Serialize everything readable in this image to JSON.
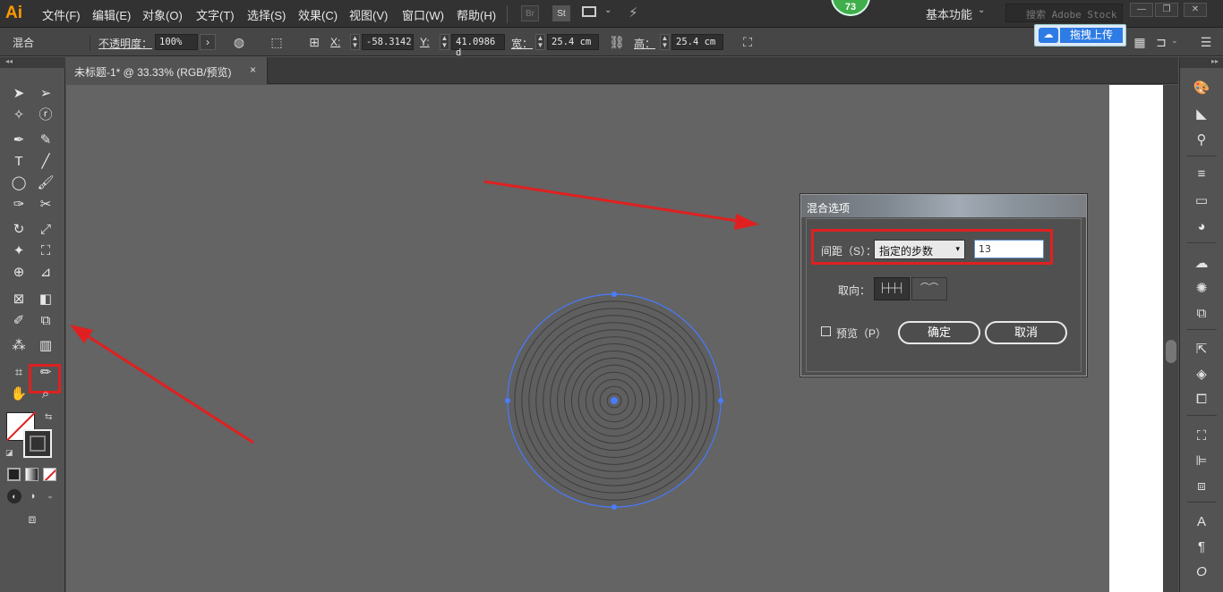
{
  "app": {
    "logo": "Ai"
  },
  "menu": [
    "文件(F)",
    "编辑(E)",
    "对象(O)",
    "文字(T)",
    "选择(S)",
    "效果(C)",
    "视图(V)",
    "窗口(W)",
    "帮助(H)"
  ],
  "menubar_buttons": {
    "br": "Br",
    "st": "St"
  },
  "badge": "73",
  "workspace": "基本功能",
  "search_placeholder": "搜索 Adobe Stock",
  "upload": {
    "label": "拖拽上传"
  },
  "control": {
    "blend_label": "混合",
    "opacity_label": "不透明度：",
    "opacity_value": "100%",
    "x_label": "X:",
    "x_value": "-58.3142",
    "y_label": "Y:",
    "y_value": "41.0986 d",
    "w_label": "宽：",
    "w_value": "25.4 cm",
    "h_label": "高：",
    "h_value": "25.4 cm"
  },
  "document_tab": {
    "title": "未标题-1* @ 33.33% (RGB/预览)",
    "close": "×"
  },
  "dialog": {
    "title": "混合选项",
    "spacing_label": "间距（S）：",
    "spacing_option": "指定的步数",
    "spacing_value": "13",
    "orientation_label": "取向：",
    "preview_label": "预览（P）",
    "ok_label": "确定",
    "cancel_label": "取消"
  },
  "artwork": {
    "ring_count": 13,
    "stroke_color": "#3d3d3d",
    "selection_color": "#4a7cff",
    "annotation_color": "#e02020"
  }
}
